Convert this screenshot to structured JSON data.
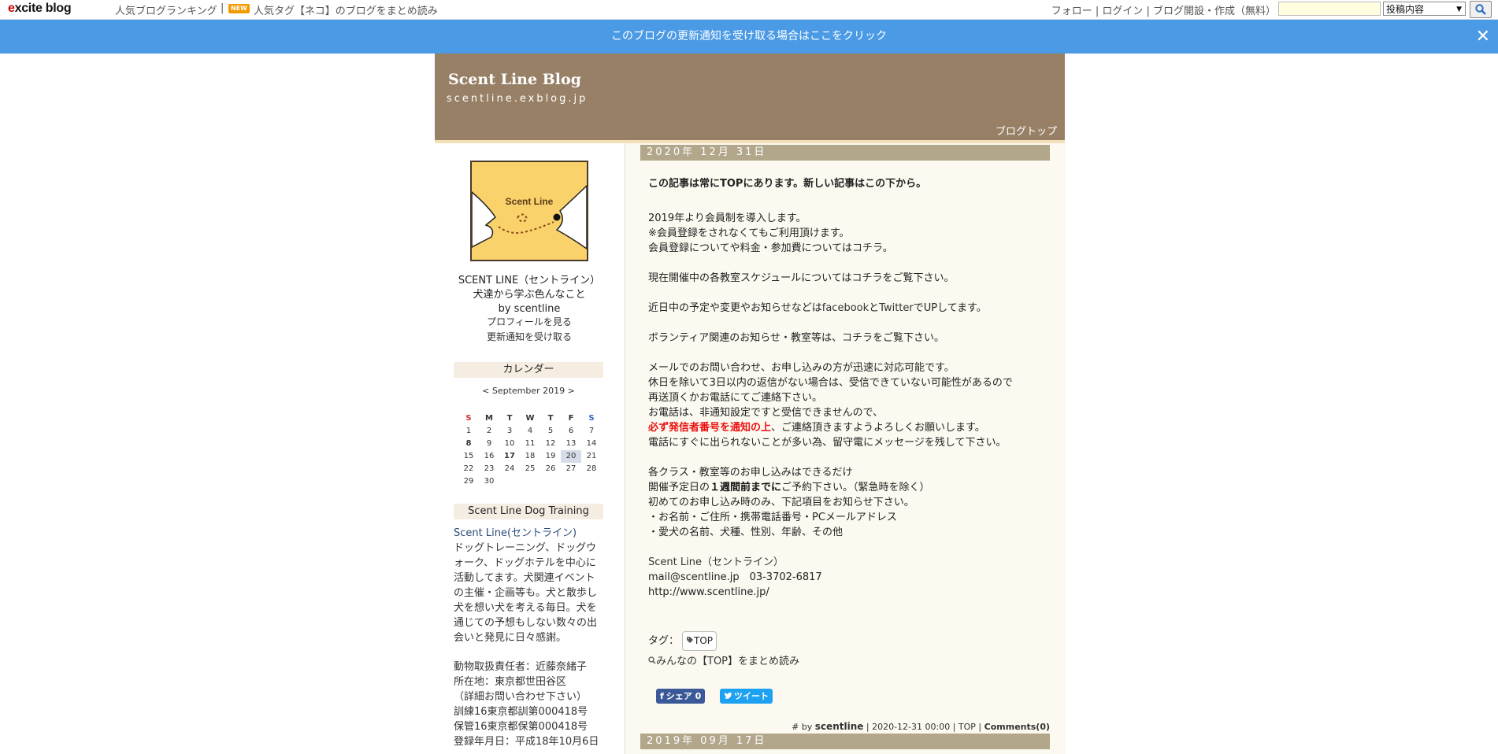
{
  "topbar": {
    "logo_prefix": "e",
    "logo_rest": "xcite blog",
    "ranking": "人気ブログランキング",
    "separator": "|",
    "new_badge": "NEW",
    "tag_link": "人気タグ【ネコ】のブログをまとめ読み",
    "right_links": "フォロー | ログイン | ブログ開設・作成（無料）",
    "select_value": "投稿内容",
    "select_arrow": "▼",
    "search_value": ""
  },
  "notice": {
    "text": "このブログの更新通知を受け取る場合はここをクリック",
    "close": "✕"
  },
  "header": {
    "title": "Scent Line Blog",
    "url": "scentline.exblog.jp",
    "top_link": "ブログトップ"
  },
  "sidebar": {
    "logo_text": "Scent Line",
    "name": "SCENT LINE（セントライン）",
    "tagline": "犬達から学ぶ色んなこと",
    "by": "by scentline",
    "profile_link": "プロフィールを見る",
    "notify_link": "更新通知を受け取る",
    "calendar_heading": "カレンダー",
    "calendar_nav": "< September 2019 >",
    "weekdays": [
      "S",
      "M",
      "T",
      "W",
      "T",
      "F",
      "S"
    ],
    "weeks": [
      [
        "1",
        "2",
        "3",
        "4",
        "5",
        "6",
        "7"
      ],
      [
        "8",
        "9",
        "10",
        "11",
        "12",
        "13",
        "14"
      ],
      [
        "15",
        "16",
        "17",
        "18",
        "19",
        "20",
        "21"
      ],
      [
        "22",
        "23",
        "24",
        "25",
        "26",
        "27",
        "28"
      ],
      [
        "29",
        "30",
        "",
        "",
        "",
        "",
        ""
      ]
    ],
    "about_heading": "Scent Line Dog Training",
    "about_link": "Scent Line(セントライン)",
    "about_lines": [
      "ドッグトレーニング、ドッグウ",
      "ォーク、ドッグホテルを中心に",
      "活動してます。犬関連イベント",
      "の主催・企画等も。犬と散歩し",
      "犬を想い犬を考える毎日。犬を",
      "通じての予想もしない数々の出",
      "会いと発見に日々感謝。"
    ],
    "license_lines": [
      "動物取扱責任者：近藤奈緒子",
      "所在地：東京都世田谷区",
      "（詳細お問い合わせ下さい）",
      "訓練16東京都訓第000418号",
      "保管16東京都保第000418号",
      "登録年月日：平成18年10月6日"
    ]
  },
  "post": {
    "date": "2020年 12月 31日",
    "lead": "この記事は常にTOPにあります。新しい記事はこの下から。",
    "l1": "2019年より会員制を導入します。",
    "l2": "※会員登録をされなくてもご利用頂けます。",
    "l3a": "会員登録についてや料金・参加費については",
    "l3link": "コチラ",
    "l3b": "。",
    "l4a": "現在開催中の各教室スケジュールについては",
    "l4link": "コチラ",
    "l4b": "をご覧下さい。",
    "l5a": "近日中の予定や変更やお知らせなどは",
    "l5fb": "facebook",
    "l5and": "と",
    "l5tw": "Twitter",
    "l5b": "でUPしてます。",
    "l6a": "ボランティア関連のお知らせ・教室等は、",
    "l6link": "コチラ",
    "l6b": "をご覧下さい。",
    "l7": "メールでのお問い合わせ、お申し込みの方が迅速に対応可能です。",
    "l8": "休日を除いて3日以内の返信がない場合は、受信できていない可能性があるので",
    "l9": "再送頂くかお電話にてご連絡下さい。",
    "l10": "お電話は、非通知設定ですと受信できませんので、",
    "l11red": "必ず発信者番号を通知の上",
    "l11b": "、ご連絡頂きますようよろしくお願いします。",
    "l12": "電話にすぐに出られないことが多い為、留守電にメッセージを残して下さい。",
    "l13": "各クラス・教室等のお申し込みはできるだけ",
    "l14a": "開催予定日の",
    "l14bold": "１週間前までに",
    "l14b": "ご予約下さい。（緊急時を除く）",
    "l15": "初めてのお申し込み時のみ、下記項目をお知らせ下さい。",
    "l16": "・お名前・ご住所・携帯電話番号・PCメールアドレス",
    "l17": "・愛犬の名前、犬種、性別、年齢、その他",
    "contact_link": "Scent Line（セントライン）",
    "contact_mail": "mail@scentline.jp　03-3702-6817",
    "contact_url": "http://www.scentline.jp/",
    "tag_label": "タグ：",
    "tag": "TOP",
    "tag_read": "みんなの【TOP】をまとめ読み",
    "share_fb": "シェア 0",
    "share_tw": "ツイート",
    "foot_prefix": "# by",
    "foot_author": "scentline",
    "foot_rest": "| 2020-12-31 00:00 | TOP |",
    "foot_comments": "Comments(0)"
  },
  "post2": {
    "date": "2019年 09月 17日"
  }
}
